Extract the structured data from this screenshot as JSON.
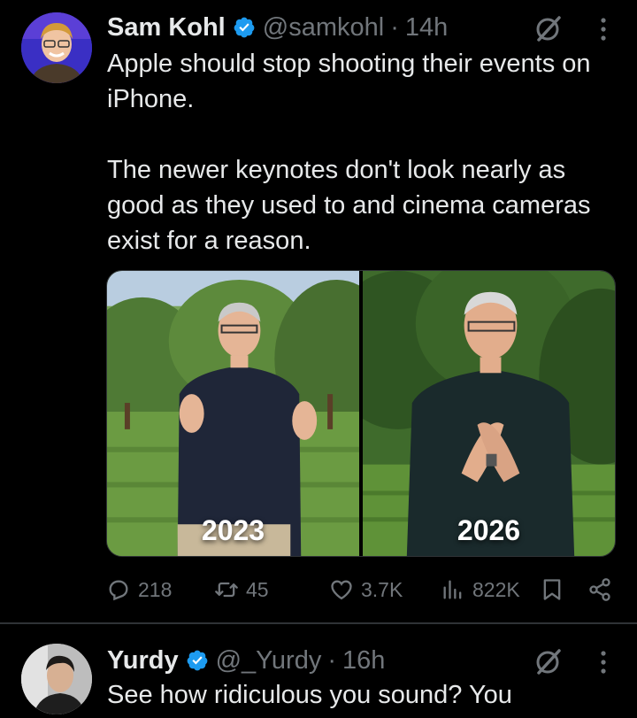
{
  "tweets": [
    {
      "author": {
        "name": "Sam Kohl",
        "handle": "@samkohl",
        "verified": true
      },
      "separator": "·",
      "time": "14h",
      "text": [
        "Apple should stop shooting their events on iPhone.",
        "The newer keynotes don't look nearly as good as they used to and cinema cameras exist for a reason."
      ],
      "media": {
        "left_label": "2023",
        "right_label": "2026"
      },
      "stats": {
        "replies": "218",
        "reposts": "45",
        "likes": "3.7K",
        "views": "822K"
      }
    },
    {
      "author": {
        "name": "Yurdy",
        "handle": "@_Yurdy",
        "verified": true
      },
      "separator": "·",
      "time": "16h",
      "text": [
        "See how ridiculous you sound? You"
      ]
    }
  ],
  "icons": {
    "verified": "verified-badge-icon",
    "grok": "grok-icon",
    "more": "more-options-icon",
    "reply": "reply-icon",
    "repost": "repost-icon",
    "like": "heart-icon",
    "views": "views-icon",
    "bookmark": "bookmark-icon",
    "share": "share-icon"
  },
  "colors": {
    "background": "#000000",
    "text": "#e7e9ea",
    "secondary": "#71767b",
    "verified": "#1d9bf0",
    "divider": "#2f3336"
  }
}
